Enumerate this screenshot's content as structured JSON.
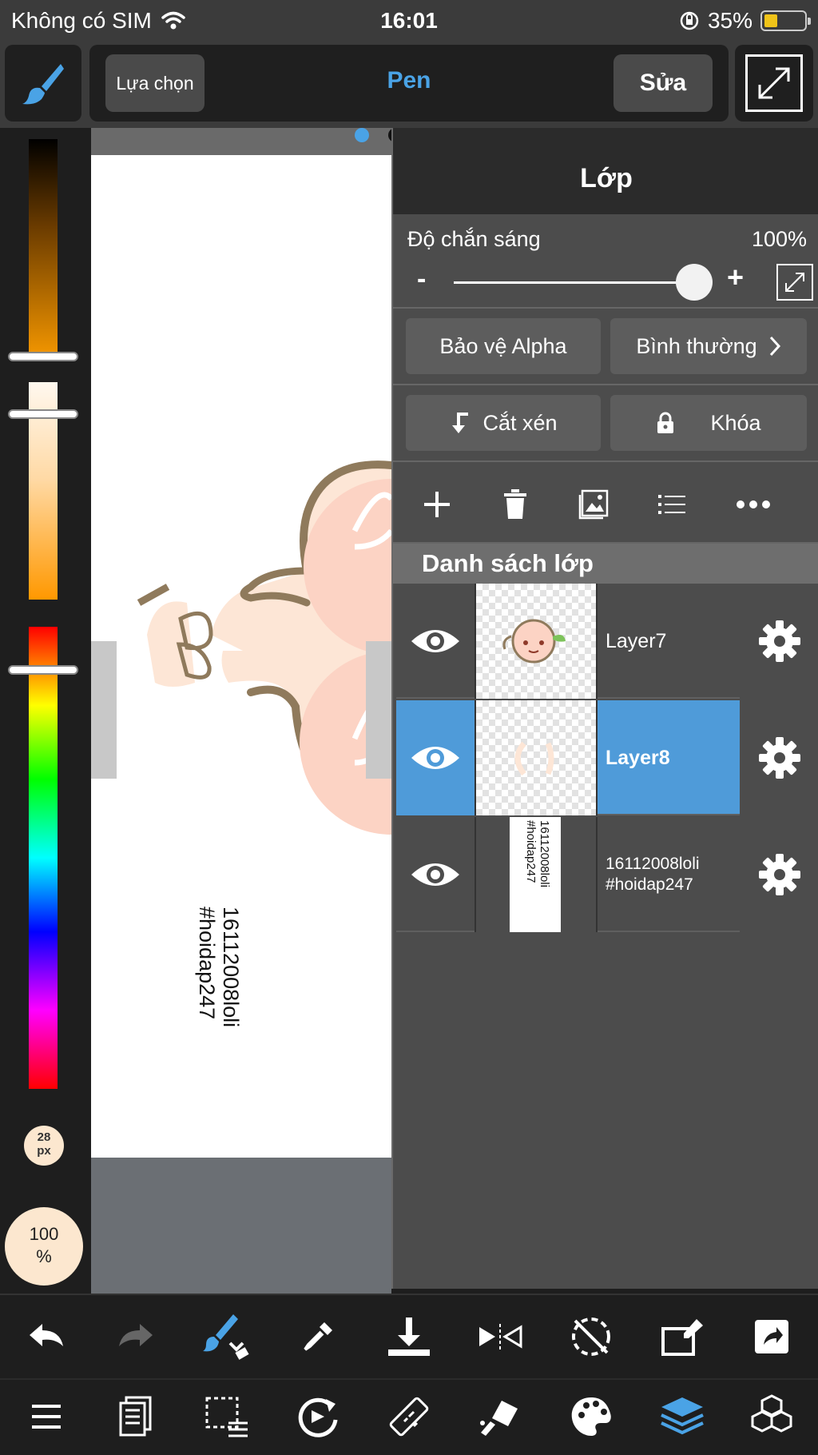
{
  "status_bar": {
    "carrier": "Không có SIM",
    "time": "16:01",
    "battery": "35%",
    "battery_level": 0.35
  },
  "toolbar": {
    "select_label": "Lựa chọn",
    "tool_title": "Pen",
    "edit_label": "Sửa"
  },
  "color_panel": {
    "brush_size": "28\npx",
    "opacity": "100\n%"
  },
  "canvas": {
    "watermark": "16112008loli\n#hoidap247"
  },
  "layer_panel": {
    "title": "Lớp",
    "opacity_label": "Độ chắn sáng",
    "opacity_value": "100%",
    "opacity_minus": "-",
    "opacity_plus": "+",
    "alpha_protect_label": "Bảo vệ Alpha",
    "blend_mode_label": "Bình thường",
    "clipping_label": "Cắt xén",
    "lock_label": "Khóa",
    "list_header": "Danh sách lớp",
    "layers": [
      {
        "name": "Layer7",
        "visible": true,
        "selected": false
      },
      {
        "name": "Layer8",
        "visible": true,
        "selected": true
      },
      {
        "name": "16112008loli\n#hoidap247",
        "visible": true,
        "selected": false
      }
    ],
    "layer3_thumb_text": "16112008loli\n#hoidap247"
  },
  "colors": {
    "accent": "#4aa3e6",
    "selected_row": "#4f9bd9",
    "panel_bg": "#4c4c4c"
  },
  "bottom_toolbar_1": [
    "undo-icon",
    "redo-icon",
    "brush-transform-icon",
    "eyedropper-icon",
    "download-icon",
    "flip-icon",
    "no-rotate-icon",
    "edit-canvas-icon",
    "share-icon"
  ],
  "bottom_toolbar_2": [
    "menu-icon",
    "pages-icon",
    "selection-icon",
    "transform-icon",
    "ruler-icon",
    "fill-icon",
    "palette-icon",
    "layers-icon",
    "materials-icon"
  ]
}
